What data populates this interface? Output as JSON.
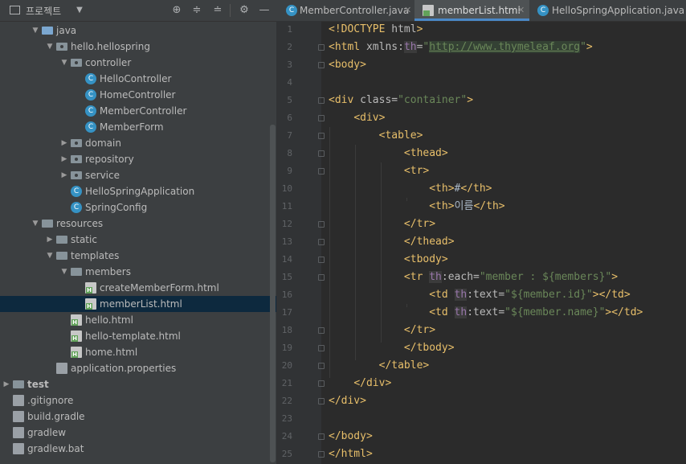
{
  "project_panel": {
    "title": "프로젝트",
    "tree": [
      {
        "label": "java",
        "icon": "folder-blue-icon",
        "arrow": "▼"
      },
      {
        "label": "hello.hellospring",
        "icon": "package-icon",
        "arrow": "▼"
      },
      {
        "label": "controller",
        "icon": "package-icon",
        "arrow": "▼"
      },
      {
        "label": "HelloController",
        "icon": "class-icon",
        "arrow": ""
      },
      {
        "label": "HomeController",
        "icon": "class-icon",
        "arrow": ""
      },
      {
        "label": "MemberController",
        "icon": "class-icon",
        "arrow": ""
      },
      {
        "label": "MemberForm",
        "icon": "class-icon",
        "arrow": ""
      },
      {
        "label": "domain",
        "icon": "package-icon",
        "arrow": "▶"
      },
      {
        "label": "repository",
        "icon": "package-icon",
        "arrow": "▶"
      },
      {
        "label": "service",
        "icon": "package-icon",
        "arrow": "▶"
      },
      {
        "label": "HelloSpringApplication",
        "icon": "spring-class-icon",
        "arrow": ""
      },
      {
        "label": "SpringConfig",
        "icon": "class-icon",
        "arrow": ""
      },
      {
        "label": "resources",
        "icon": "resources-folder-icon",
        "arrow": "▼"
      },
      {
        "label": "static",
        "icon": "folder-icon",
        "arrow": "▶"
      },
      {
        "label": "templates",
        "icon": "folder-icon",
        "arrow": "▼"
      },
      {
        "label": "members",
        "icon": "folder-icon",
        "arrow": "▼"
      },
      {
        "label": "createMemberForm.html",
        "icon": "html-file-icon",
        "arrow": ""
      },
      {
        "label": "memberList.html",
        "icon": "html-file-icon",
        "arrow": "",
        "selected": true
      },
      {
        "label": "hello.html",
        "icon": "html-file-icon",
        "arrow": ""
      },
      {
        "label": "hello-template.html",
        "icon": "html-file-icon",
        "arrow": ""
      },
      {
        "label": "home.html",
        "icon": "html-file-icon",
        "arrow": ""
      },
      {
        "label": "application.properties",
        "icon": "properties-file-icon",
        "arrow": ""
      },
      {
        "label": "test",
        "icon": "folder-icon",
        "arrow": "▶"
      },
      {
        "label": ".gitignore",
        "icon": "gitignore-icon",
        "arrow": ""
      },
      {
        "label": "build.gradle",
        "icon": "gradle-icon",
        "arrow": ""
      },
      {
        "label": "gradlew",
        "icon": "file-icon",
        "arrow": ""
      },
      {
        "label": "gradlew.bat",
        "icon": "file-icon",
        "arrow": ""
      }
    ]
  },
  "tabs": [
    {
      "label": "MemberController.java",
      "icon": "class-icon",
      "active": false
    },
    {
      "label": "memberList.html",
      "icon": "html-file-icon",
      "active": true
    },
    {
      "label": "HelloSpringApplication.java",
      "icon": "spring-class-icon",
      "active": false
    }
  ],
  "editor": {
    "line_numbers": [
      "1",
      "2",
      "3",
      "4",
      "5",
      "6",
      "7",
      "8",
      "9",
      "10",
      "11",
      "12",
      "13",
      "14",
      "15",
      "16",
      "17",
      "18",
      "19",
      "20",
      "21",
      "22",
      "23",
      "24",
      "25"
    ]
  },
  "colors": {
    "accent": "#4a88c7",
    "tag": "#e8bf6a",
    "string": "#6a8759",
    "namespace": "#9876aa",
    "selection": "#0d293e"
  }
}
